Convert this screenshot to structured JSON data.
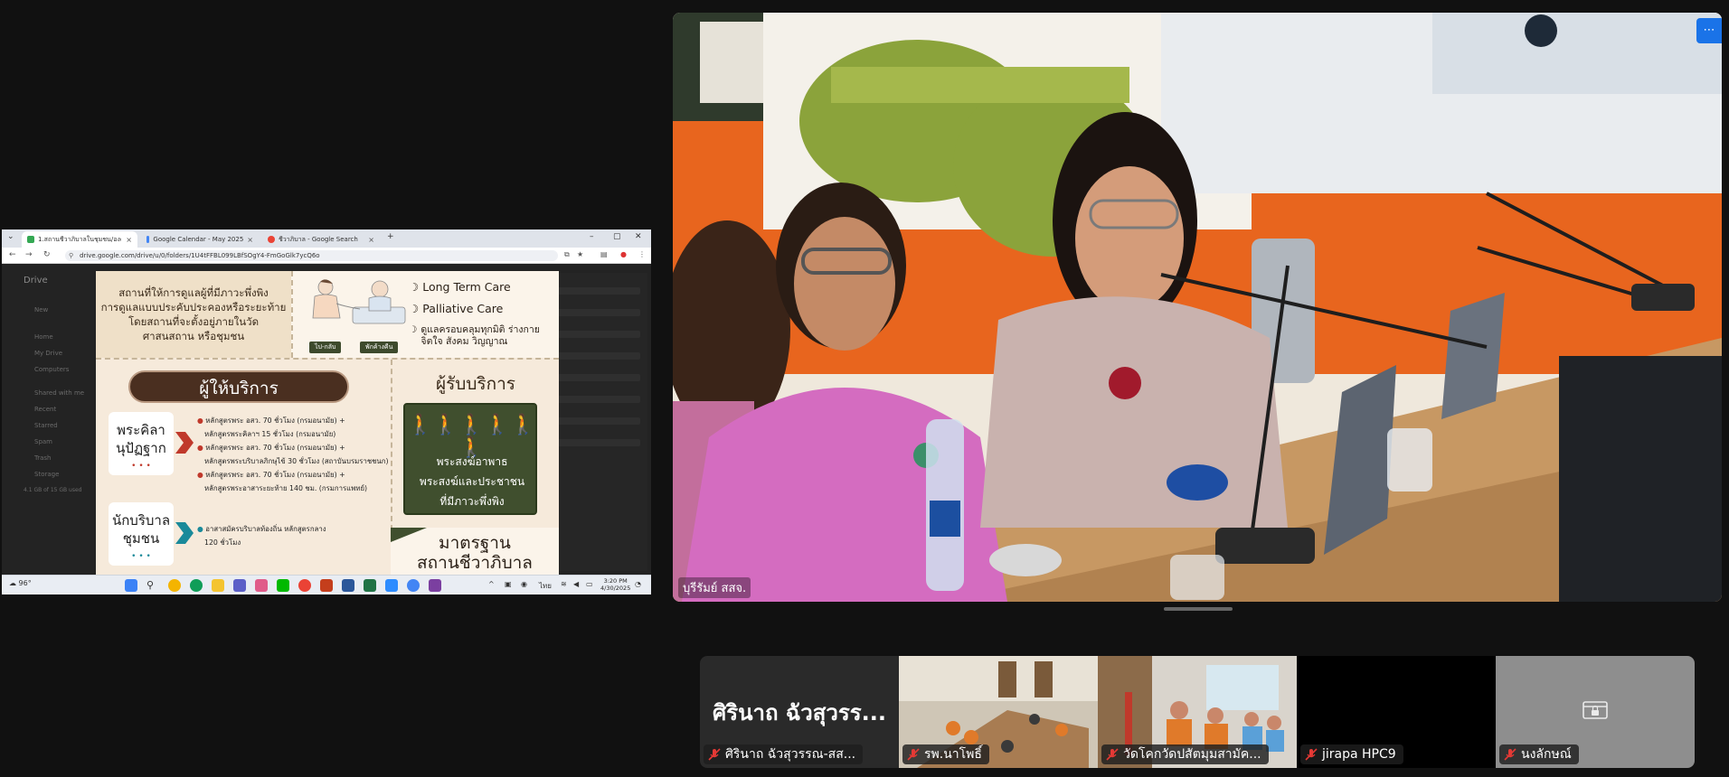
{
  "browser": {
    "tabs": [
      {
        "label": "1.สถานชีวาภิบาลในชุมชน/องค์กร ..."
      },
      {
        "label": "Google Calendar - May 2025"
      },
      {
        "label": "ชีวาภิบาล - Google Search"
      }
    ],
    "new_tab": "+",
    "url": "drive.google.com/drive/u/0/folders/1U4tFFBL099LBfSOgY4-FmGoGlk7ycQ6o"
  },
  "drive": {
    "app_name": "Drive",
    "new_label": "New",
    "nav": [
      "Home",
      "My Drive",
      "Computers",
      "Shared with me",
      "Recent",
      "Starred",
      "Spam",
      "Trash",
      "Storage"
    ],
    "storage": "4.1 GB of 15 GB used"
  },
  "slide": {
    "place_text": [
      "สถานที่ให้การดูแลผู้ที่มีภาวะพึ่งพิง",
      "การดูแลแบบประคับประคองหรือระยะท้าย",
      "โดยสถานที่จะตั้งอยู่ภายในวัด",
      "ศาสนสถาน หรือชุมชน"
    ],
    "care_items": [
      "Long Term Care",
      "Palliative Care"
    ],
    "holistic": [
      "ดูแลครอบคลุมทุกมิติ ร่างกาย",
      "จิตใจ สังคม วิญญาณ"
    ],
    "pills": [
      "ไป-กลับ",
      "พักค้างคืน"
    ],
    "provider_title": "ผู้ให้บริการ",
    "providers": [
      {
        "name_lines": [
          "พระคิลา",
          "นุปัฏฐาก"
        ],
        "dots": "• • •",
        "lines": [
          "หลักสูตรพระ อสว. 70 ชั่วโมง (กรมอนามัย) +",
          "หลักสูตรพระคิลาฯ 15 ชั่วโมง (กรมอนามัย)",
          "หลักสูตรพระ อสว. 70 ชั่วโมง (กรมอนามัย) +",
          "หลักสูตรพระบริบาลภิกษุไข้ 30 ชั่วโมง (สถาบันบรมราชชนก)",
          "หลักสูตรพระ อสว. 70 ชั่วโมง (กรมอนามัย) +",
          "หลักสูตรพระอาสาระยะท้าย 140 ชม. (กรมการแพทย์)"
        ]
      },
      {
        "name_lines": [
          "นักบริบาล",
          "ชุมชน"
        ],
        "dots": "• • •",
        "lines": [
          "อาสาสมัครบริบาลท้องถิ่น หลักสูตรกลาง",
          "120 ชั่วโมง"
        ]
      }
    ],
    "receiver_title": "ผู้รับบริการ",
    "receiver_people": "🚶🚶🚶🚶🚶🚶",
    "receiver_text": [
      "พระสงฆ์อาพาธ",
      "พระสงฆ์และประชาชน",
      "ที่มีภาวะพึ่งพิง"
    ],
    "standard_title": [
      "มาตรฐาน",
      "สถานชีวาภิบาล"
    ]
  },
  "taskbar": {
    "weather": "96°",
    "time": "3:20 PM",
    "date": "4/30/2025",
    "lang": "ไทย"
  },
  "main_video": {
    "label": "บุรีรัมย์ สสจ.",
    "more": "⋯"
  },
  "participants": [
    {
      "big_name": "ศิรินาถ ฉัวสุวรร...",
      "label": "ศิรินาถ ฉัวสุวรรณ-สส...",
      "muted": true,
      "type": "name"
    },
    {
      "label": "รพ.นาโพธิ์",
      "muted": true,
      "type": "video"
    },
    {
      "label": "วัดโคกวัดปสัตมุมสามัค...",
      "muted": true,
      "type": "video"
    },
    {
      "label": "jirapa HPC9",
      "muted": true,
      "type": "black"
    },
    {
      "label": "นงลักษณ์",
      "muted": true,
      "type": "locked"
    }
  ],
  "colors": {
    "background": "#111111",
    "accent_blue": "#1a73e8",
    "mic_off_red": "#e53935",
    "slide_brown": "#4a2f20",
    "slide_green": "#404f2e"
  }
}
